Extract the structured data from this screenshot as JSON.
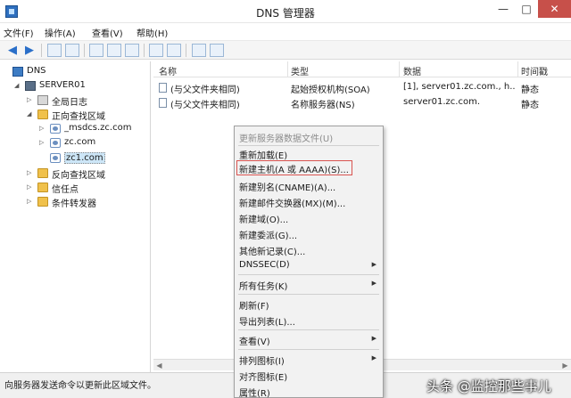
{
  "window": {
    "title": "DNS 管理器",
    "minimize": "—",
    "maximize": "□",
    "close": "✕"
  },
  "menu": [
    "文件(F)",
    "操作(A)",
    "查看(V)",
    "帮助(H)"
  ],
  "tree": {
    "root": "DNS",
    "server": "SERVER01",
    "global_log": "全局日志",
    "forward_zones": "正向查找区域",
    "zones": [
      "_msdcs.zc.com",
      "zc.com",
      "zc1.com"
    ],
    "reverse_zones": "反向查找区域",
    "trust_points": "信任点",
    "conditional_forwarders": "条件转发器"
  },
  "list": {
    "columns": [
      "名称",
      "类型",
      "数据",
      "时间戳"
    ],
    "rows": [
      {
        "name": "(与父文件夹相同)",
        "type": "起始授权机构(SOA)",
        "data": "[1], server01.zc.com., h...",
        "timestamp": "静态"
      },
      {
        "name": "(与父文件夹相同)",
        "type": "名称服务器(NS)",
        "data": "server01.zc.com.",
        "timestamp": "静态"
      }
    ]
  },
  "context_menu": {
    "items": [
      {
        "label": "更新服务器数据文件(U)",
        "disabled": true
      },
      {
        "label": "重新加载(E)"
      },
      {
        "label": "新建主机(A 或 AAAA)(S)...",
        "highlighted": true
      },
      {
        "label": "新建别名(CNAME)(A)..."
      },
      {
        "label": "新建邮件交换器(MX)(M)..."
      },
      {
        "label": "新建域(O)..."
      },
      {
        "label": "新建委派(G)..."
      },
      {
        "label": "其他新记录(C)..."
      },
      {
        "label": "DNSSEC(D)",
        "submenu": true
      },
      {
        "label": "所有任务(K)",
        "submenu": true
      },
      {
        "label": "刷新(F)"
      },
      {
        "label": "导出列表(L)..."
      },
      {
        "label": "查看(V)",
        "submenu": true
      },
      {
        "label": "排列图标(I)",
        "submenu": true
      },
      {
        "label": "对齐图标(E)"
      },
      {
        "label": "属性(R)"
      }
    ],
    "submenu_arrow": "▶"
  },
  "status_bar": {
    "text": "向服务器发送命令以更新此区域文件。"
  },
  "watermark": "头条 @监控那些事儿",
  "colors": {
    "close_button": "#c7504a",
    "highlight_border": "#d9534f",
    "selection": "#cde6f7"
  }
}
